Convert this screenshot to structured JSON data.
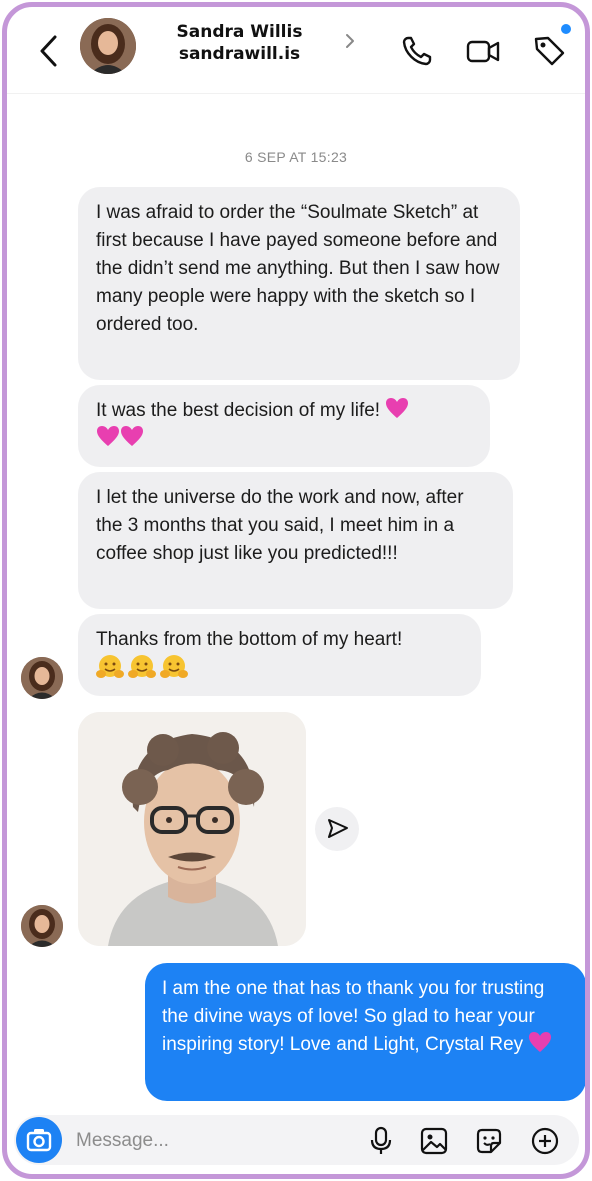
{
  "header": {
    "contact_name": "Sandra Willis",
    "contact_handle": "sandrawill.is",
    "icons": [
      "back-arrow-icon",
      "chevron-right-icon",
      "phone-icon",
      "video-camera-icon",
      "tag-icon"
    ],
    "notification_dot_color": "#1e8cff"
  },
  "conversation": {
    "date_label": "6 SEP AT 15:23",
    "incoming": [
      {
        "text": "I was afraid to order the “Soulmate Sketch” at first because I have payed someone before and the didn’t send me anything. But then I saw how many people were happy with the sketch so I ordered too."
      },
      {
        "text": "It was the best decision of my life!",
        "emoji": "pink-heart x3"
      },
      {
        "text": "I let the universe do the work and now, after the 3 months that you said, I meet him in a coffee shop just like you predicted!!!"
      },
      {
        "text": "Thanks from the bottom of my heart!",
        "emoji": "hugging-face x3"
      }
    ],
    "image_message": {
      "description_icon": "portrait-sketch-image",
      "share_icon": "send-icon"
    },
    "outgoing": {
      "text": "I am the one that has to thank you for trusting the divine ways of love! So glad to hear your inspiring story! Love and Light, Crystal Rey",
      "emoji": "pink-heart",
      "color": "#1d82f4"
    }
  },
  "composer": {
    "placeholder": "Message...",
    "icons": [
      "camera-icon",
      "microphone-icon",
      "gallery-icon",
      "sticker-icon",
      "add-icon"
    ]
  },
  "colors": {
    "frame_border": "#c497d8",
    "incoming_bubble": "#efeff1",
    "accent": "#1d82f4"
  }
}
